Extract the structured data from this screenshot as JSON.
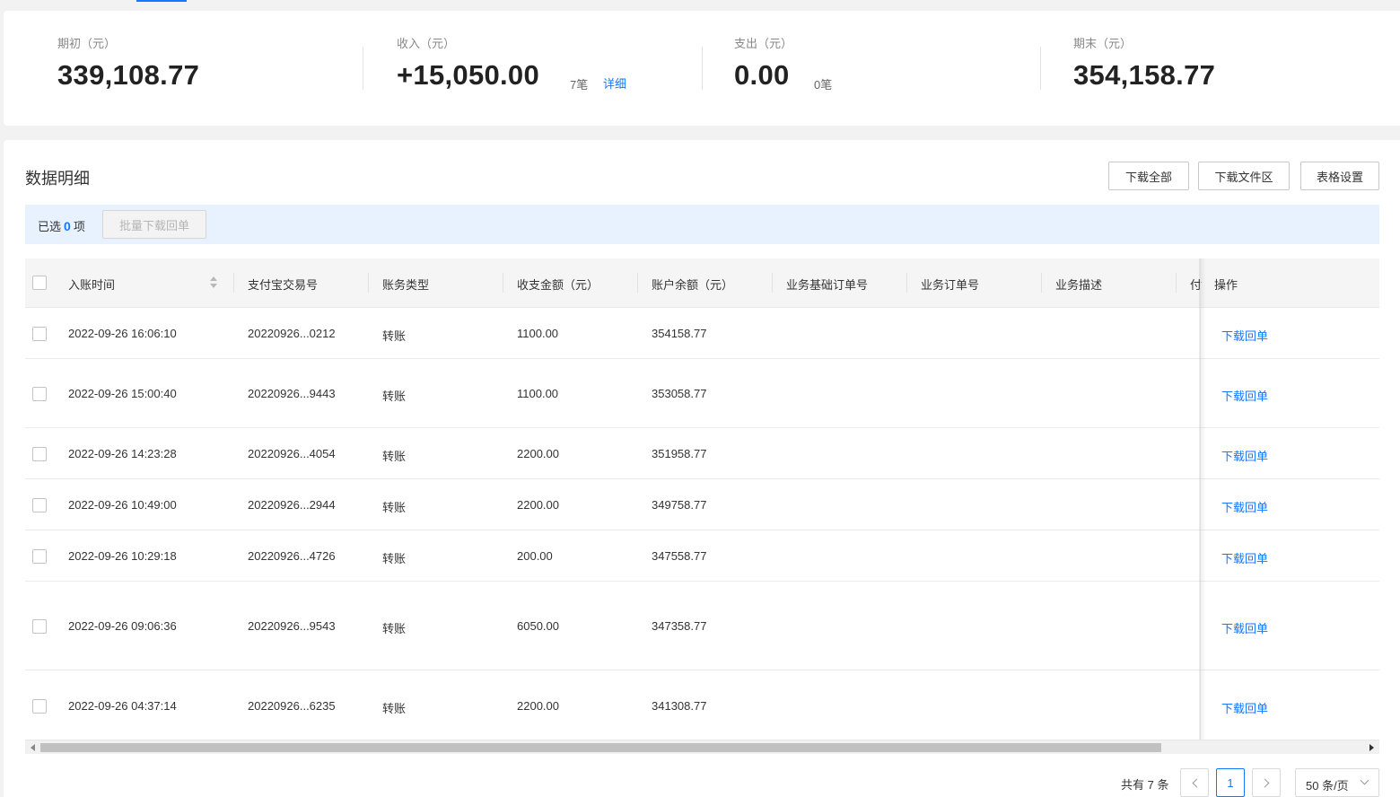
{
  "summary": {
    "opening": {
      "label": "期初（元）",
      "value": "339,108.77"
    },
    "income": {
      "label": "收入（元）",
      "value": "+15,050.00",
      "count": "7笔",
      "detail": "详细"
    },
    "expense": {
      "label": "支出（元）",
      "value": "0.00",
      "count": "0笔"
    },
    "closing": {
      "label": "期末（元）",
      "value": "354,158.77"
    }
  },
  "panel": {
    "title": "数据明细",
    "buttons": {
      "download_all": "下载全部",
      "download_area": "下载文件区",
      "table_settings": "表格设置"
    }
  },
  "selection": {
    "prefix": "已选",
    "count": "0",
    "suffix": "项",
    "batch_button": "批量下载回单"
  },
  "table": {
    "columns": [
      "入账时间",
      "支付宝交易号",
      "账务类型",
      "收支金额（元）",
      "账户余额（元）",
      "业务基础订单号",
      "业务订单号",
      "业务描述",
      "付",
      "操作"
    ],
    "rows": [
      {
        "time": "2022-09-26 16:06:10",
        "trade_no": "20220926...0212",
        "type": "转账",
        "amount": "1100.00",
        "balance": "354158.77",
        "action": "下载回单"
      },
      {
        "time": "2022-09-26 15:00:40",
        "trade_no": "20220926...9443",
        "type": "转账",
        "amount": "1100.00",
        "balance": "353058.77",
        "action": "下载回单"
      },
      {
        "time": "2022-09-26 14:23:28",
        "trade_no": "20220926...4054",
        "type": "转账",
        "amount": "2200.00",
        "balance": "351958.77",
        "action": "下载回单"
      },
      {
        "time": "2022-09-26 10:49:00",
        "trade_no": "20220926...2944",
        "type": "转账",
        "amount": "2200.00",
        "balance": "349758.77",
        "action": "下载回单"
      },
      {
        "time": "2022-09-26 10:29:18",
        "trade_no": "20220926...4726",
        "type": "转账",
        "amount": "200.00",
        "balance": "347558.77",
        "action": "下载回单"
      },
      {
        "time": "2022-09-26 09:06:36",
        "trade_no": "20220926...9543",
        "type": "转账",
        "amount": "6050.00",
        "balance": "347358.77",
        "action": "下载回单"
      },
      {
        "time": "2022-09-26 04:37:14",
        "trade_no": "20220926...6235",
        "type": "转账",
        "amount": "2200.00",
        "balance": "341308.77",
        "action": "下载回单"
      }
    ]
  },
  "pagination": {
    "total": "共有 7 条",
    "current_page": "1",
    "page_size": "50 条/页"
  },
  "colors": {
    "accent": "#1677ff",
    "selection_bar": "#e8f1fe"
  }
}
